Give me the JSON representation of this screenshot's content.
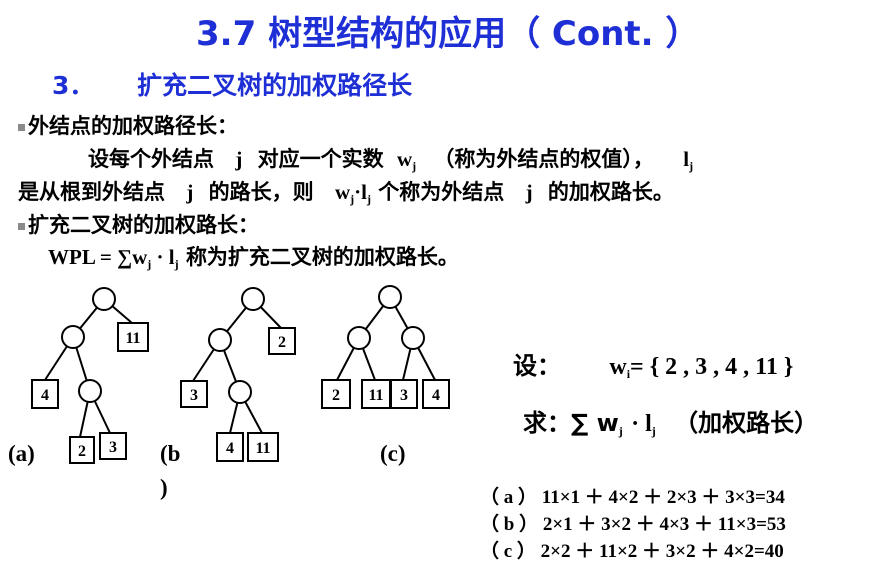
{
  "title": "3.7  树型结构的应用（ Cont. ）",
  "subtitle": {
    "num": "3．",
    "text": "扩充二叉树的加权路径长"
  },
  "section1": {
    "heading": "外结点的加权路径长：",
    "line1_a": "设每个外结点",
    "line1_j": "j",
    "line1_b": "对应一个实数",
    "line1_w": "w",
    "line1_wsub": "j",
    "line1_c": "（称为外结点的权值），",
    "line1_l": "l",
    "line1_lsub": "j",
    "line2_a": "是从根到外结点",
    "line2_j": "j",
    "line2_b": "的路长，则",
    "line2_w": "w",
    "line2_wsub": "j",
    "line2_dot": "·",
    "line2_l": "l",
    "line2_lsub": "j",
    "line2_c": "个称为外结点",
    "line2_j2": "j",
    "line2_d": "的加权路长。"
  },
  "section2": {
    "heading": "扩充二叉树的加权路长：",
    "wpl": "WPL = ∑w",
    "wpl_sub": "j",
    "wpl_dot": " · l",
    "wpl_lsub": "j",
    "wpl_tail": "称为扩充二叉树的加权路长。"
  },
  "trees": {
    "a": {
      "label": "(a)",
      "leaves": [
        "11",
        "4",
        "2",
        "3"
      ]
    },
    "b": {
      "label": "(b",
      "label2": ")",
      "leaves": [
        "2",
        "3",
        "4",
        "11"
      ]
    },
    "c": {
      "label": "(c)",
      "leaves": [
        "2",
        "11",
        "3",
        "4"
      ]
    }
  },
  "given": {
    "prefix": "设：",
    "w": "w",
    "wsub": "i",
    "set": "= { 2 , 3 , 4 , 11 }"
  },
  "ask": {
    "prefix": "求：∑ w",
    "wsub": "j",
    "mid": "· l",
    "lsub": "j",
    "tail": "（加权路长）"
  },
  "results": [
    "（ a ）  11×1 ＋ 4×2 ＋ 2×3 ＋ 3×3=34",
    "（ b ）  2×1 ＋ 3×2 ＋ 4×3 ＋ 11×3=53",
    "（ c ）  2×2 ＋ 11×2 ＋ 3×2 ＋ 4×2=40"
  ]
}
